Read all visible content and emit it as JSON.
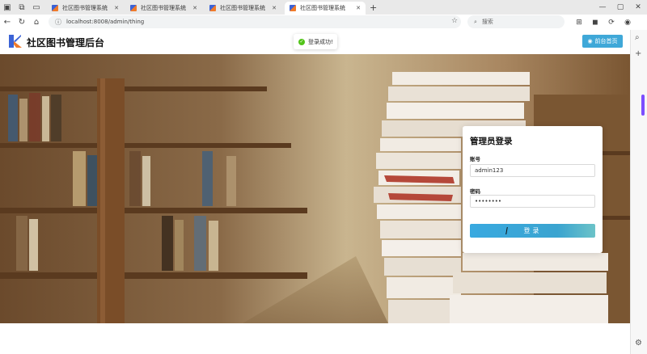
{
  "browser": {
    "tabs": [
      {
        "title": "社区图书管理系统",
        "active": false
      },
      {
        "title": "社区图书管理系统",
        "active": false
      },
      {
        "title": "社区图书管理系统",
        "active": false
      },
      {
        "title": "社区图书管理系统",
        "active": true
      }
    ],
    "url": "localhost:8008/admin/thing",
    "search_placeholder": "搜索"
  },
  "header": {
    "brand": "社区图书管理后台",
    "front_button": "前台首页"
  },
  "toast": {
    "message": "登录成功!"
  },
  "login": {
    "title": "管理员登录",
    "account_label": "账号",
    "account_value": "admin123",
    "password_label": "密码",
    "password_value": "••••••••",
    "submit_label": "登录"
  },
  "colors": {
    "accent": "#3fa8d8",
    "success": "#52c41a",
    "logo_blue": "#3c63d6",
    "logo_orange": "#f07a2a"
  }
}
